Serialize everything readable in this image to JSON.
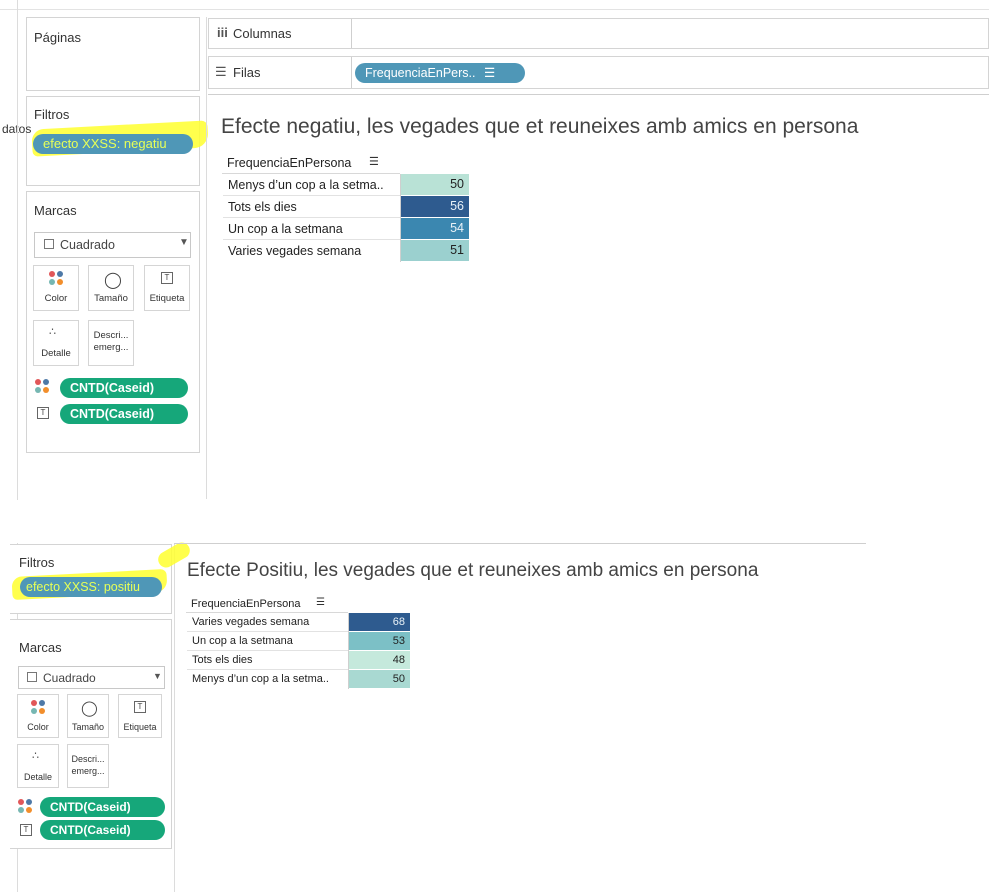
{
  "top": {
    "paginas_label": "Páginas",
    "columnas_label": "Columnas",
    "filas_label": "Filas",
    "filas_pill": "FrequenciaEnPers..",
    "filtros_label": "Filtros",
    "datos_fragment": "datos",
    "filter_pill": "efecto XXSS: negatiu",
    "marcas_label": "Marcas",
    "mark_type": "Cuadrado",
    "cards": {
      "color": "Color",
      "size": "Tamaño",
      "label": "Etiqueta",
      "detail": "Detalle",
      "tooltip_line1": "Descri...",
      "tooltip_line2": "emerg..."
    },
    "field_color": "CNTD(Caseid)",
    "field_label": "CNTD(Caseid)",
    "viz_title": "Efecte negatiu, les vegades que et reuneixes amb amics en persona",
    "col_header": "FrequenciaEnPersona",
    "rows": [
      {
        "label": "Menys d’un cop a la setma..",
        "value": "50",
        "color": "#b9e2d6"
      },
      {
        "label": "Tots els dies",
        "value": "56",
        "color": "#2e5b8f"
      },
      {
        "label": "Un cop a la setmana",
        "value": "54",
        "color": "#3b87b0"
      },
      {
        "label": "Varies vegades semana",
        "value": "51",
        "color": "#9bd0cf"
      }
    ]
  },
  "bottom": {
    "filtros_label": "Filtros",
    "filter_pill": "efecto XXSS: positiu",
    "marcas_label": "Marcas",
    "mark_type": "Cuadrado",
    "cards": {
      "color": "Color",
      "size": "Tamaño",
      "label": "Etiqueta",
      "detail": "Detalle",
      "tooltip_line1": "Descri...",
      "tooltip_line2": "emerg..."
    },
    "field_color": "CNTD(Caseid)",
    "field_label": "CNTD(Caseid)",
    "viz_title": "Efecte Positiu, les vegades que et reuneixes amb amics en persona",
    "col_header": "FrequenciaEnPersona",
    "rows": [
      {
        "label": "Varies vegades semana",
        "value": "68",
        "color": "#2e5b8f"
      },
      {
        "label": "Un cop a la setmana",
        "value": "53",
        "color": "#7cc0c6"
      },
      {
        "label": "Tots els dies",
        "value": "48",
        "color": "#c5e9dc"
      },
      {
        "label": "Menys d’un cop a la setma..",
        "value": "50",
        "color": "#a9d9d2"
      }
    ]
  },
  "colors": {
    "pill_blue": "#4f97b7",
    "pill_green": "#16a77a",
    "highlight": "#ffff2e"
  },
  "icons": {
    "columns": "columns-icon",
    "rows": "rows-icon",
    "sort": "sort-descending-icon",
    "sort_bottom": "sort-ascending-icon",
    "color": "color-dots-icon",
    "size": "size-lasso-icon",
    "label": "text-label-icon",
    "detail": "detail-dots-icon",
    "dropdown": "chevron-down-icon",
    "square": "square-mark-icon"
  }
}
